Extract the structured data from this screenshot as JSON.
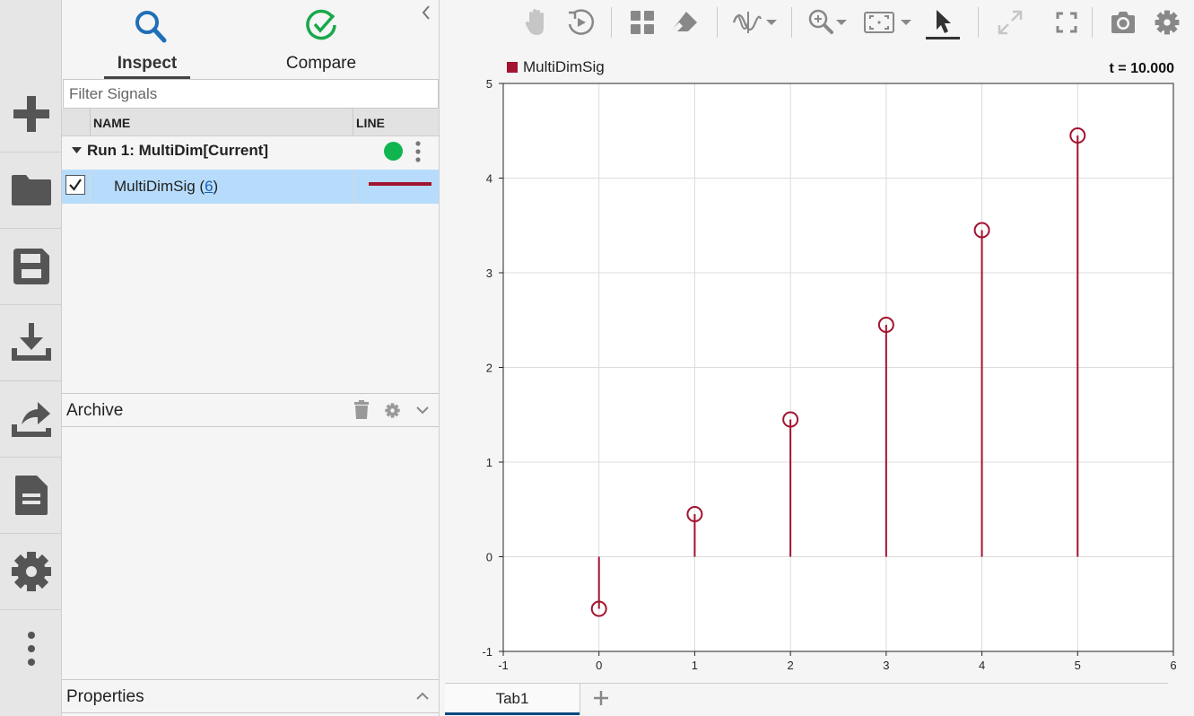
{
  "left_panel": {
    "tabs": [
      {
        "label": "Inspect",
        "icon": "search-icon",
        "active": true
      },
      {
        "label": "Compare",
        "icon": "check-circle-icon",
        "active": false
      }
    ],
    "filter_placeholder": "Filter Signals",
    "columns": {
      "name": "NAME",
      "line": "LINE"
    },
    "run": {
      "label": "Run 1: MultiDim[Current]",
      "status_color": "#11b550"
    },
    "signal": {
      "name": "MultiDimSig",
      "count": "6",
      "checked": true,
      "line_color": "#a2142f"
    },
    "archive": {
      "title": "Archive"
    },
    "properties": {
      "title": "Properties"
    }
  },
  "rail": [
    "add-icon",
    "folder-icon",
    "save-icon",
    "download-icon",
    "share-icon",
    "document-icon",
    "gear-icon",
    "more-vertical-icon"
  ],
  "plot": {
    "legend_label": "MultiDimSig",
    "time_label": "t = 10.000",
    "tab_label": "Tab1"
  },
  "chart_data": {
    "type": "stem",
    "series": [
      {
        "name": "MultiDimSig",
        "color": "#a2142f",
        "x": [
          0,
          1,
          2,
          3,
          4,
          5
        ],
        "y": [
          -0.55,
          0.45,
          1.45,
          2.45,
          3.45,
          4.45
        ]
      }
    ],
    "xlim": [
      -1,
      6
    ],
    "ylim": [
      -1,
      5
    ],
    "xticks": [
      -1,
      0,
      1,
      2,
      3,
      4,
      5,
      6
    ],
    "yticks": [
      -1,
      0,
      1,
      2,
      3,
      4,
      5
    ],
    "grid": true
  }
}
